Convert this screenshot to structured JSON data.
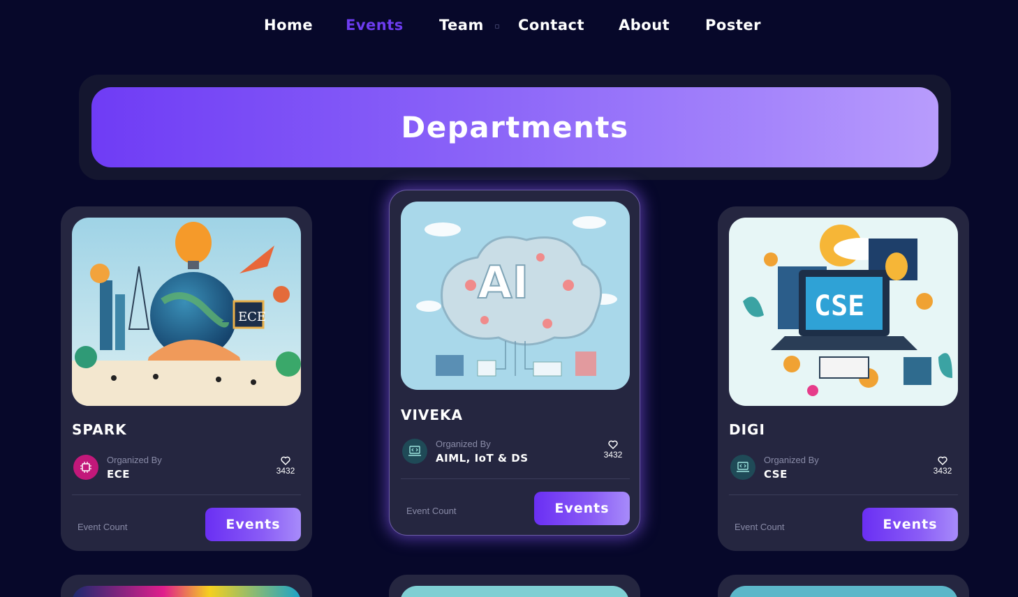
{
  "nav": {
    "items": [
      {
        "label": "Home",
        "active": false
      },
      {
        "label": "Events",
        "active": true
      },
      {
        "label": "Team",
        "active": false
      },
      {
        "label": "Contact",
        "active": false
      },
      {
        "label": "About",
        "active": false
      },
      {
        "label": "Poster",
        "active": false
      }
    ]
  },
  "banner": {
    "title": "Departments"
  },
  "colors": {
    "background": "#07082a",
    "card": "#252640",
    "accent": "#6d3cf0",
    "banner_start": "#6f3cf5",
    "banner_end": "#b89cfc"
  },
  "cards": [
    {
      "title": "SPARK",
      "organized_by_label": "Organized By",
      "organizer": "ECE",
      "likes": "3432",
      "event_count_label": "Event Count",
      "button_label": "Events",
      "image_text": "ECE",
      "org_icon": "circuit-chip-icon"
    },
    {
      "title": "VIVEKA",
      "organized_by_label": "Organized By",
      "organizer": "AIML, IoT & DS",
      "likes": "3432",
      "event_count_label": "Event Count",
      "button_label": "Events",
      "image_text": "AI",
      "org_icon": "code-laptop-icon"
    },
    {
      "title": "DIGI",
      "organized_by_label": "Organized By",
      "organizer": "CSE",
      "likes": "3432",
      "event_count_label": "Event Count",
      "button_label": "Events",
      "image_text": "CSE",
      "org_icon": "code-laptop-icon"
    }
  ]
}
